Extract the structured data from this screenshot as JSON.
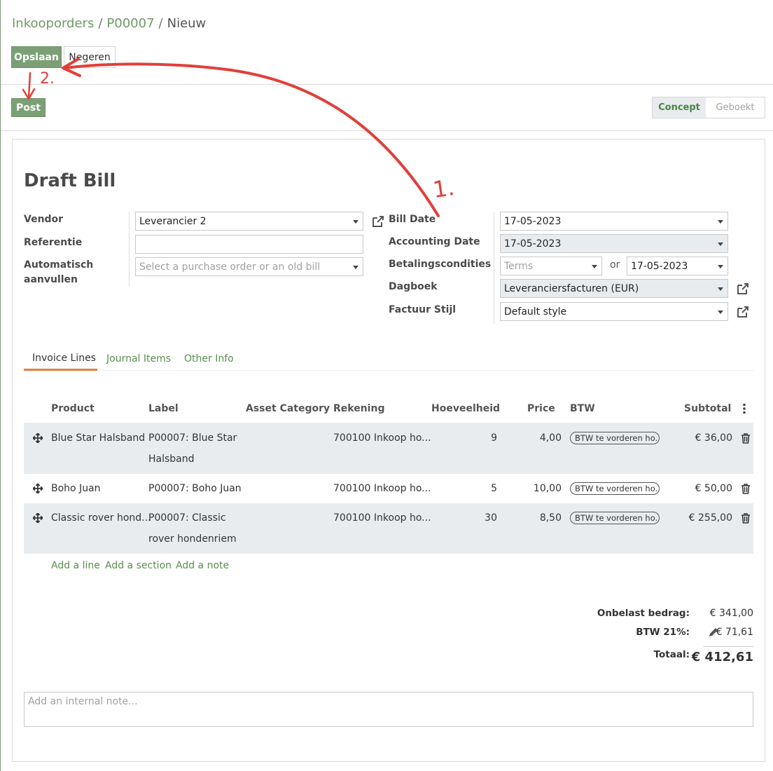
{
  "breadcrumb": {
    "root": "Inkooporders",
    "order": "P00007",
    "current": "Nieuw",
    "sep": "/"
  },
  "toolbar": {
    "save_label": "Opslaan",
    "discard_label": "Negeren",
    "post_label": "Post"
  },
  "status": {
    "active": "Concept",
    "next": "Geboekt"
  },
  "form": {
    "title": "Draft Bill",
    "vendor_label": "Vendor",
    "vendor_value": "Leverancier 2",
    "reference_label": "Referentie",
    "reference_value": "",
    "autofill_label_1": "Automatisch",
    "autofill_label_2": "aanvullen",
    "autofill_placeholder": "Select a purchase order or an old bill",
    "bill_date_label": "Bill Date",
    "bill_date_value": "17-05-2023",
    "accounting_date_label": "Accounting Date",
    "accounting_date_value": "17-05-2023",
    "payment_terms_label": "Betalingscondities",
    "terms_placeholder": "Terms",
    "or_label": "or",
    "due_date_value": "17-05-2023",
    "journal_label": "Dagboek",
    "journal_value": "Leveranciersfacturen (EUR)",
    "invoice_style_label": "Factuur Stijl",
    "invoice_style_value": "Default style"
  },
  "tabs": [
    {
      "label": "Invoice Lines",
      "active": true
    },
    {
      "label": "Journal Items",
      "active": false
    },
    {
      "label": "Other Info",
      "active": false
    }
  ],
  "table": {
    "headers": {
      "product": "Product",
      "label": "Label",
      "asset": "Asset Category ...",
      "account": "Rekening",
      "qty": "Hoeveelheid",
      "price": "Price",
      "tax": "BTW",
      "subtotal": "Subtotal"
    },
    "rows": [
      {
        "product": "Blue Star Halsband",
        "label_1": "P00007: Blue Star",
        "label_2": "Halsband",
        "account": "700100 Inkoop ho...",
        "qty": "9",
        "price": "4,00",
        "tax": "BTW te vorderen ho...",
        "subtotal": "€ 36,00"
      },
      {
        "product": "Boho Juan",
        "label_1": "P00007: Boho Juan",
        "label_2": "",
        "account": "700100 Inkoop ho...",
        "qty": "5",
        "price": "10,00",
        "tax": "BTW te vorderen ho...",
        "subtotal": "€ 50,00"
      },
      {
        "product": "Classic rover hond...",
        "label_1": "P00007: Classic",
        "label_2": "rover hondenriem",
        "account": "700100 Inkoop ho...",
        "qty": "30",
        "price": "8,50",
        "tax": "BTW te vorderen ho...",
        "subtotal": "€ 255,00"
      }
    ],
    "add_line": "Add a line",
    "add_section": "Add a section",
    "add_note": "Add a note"
  },
  "totals": {
    "untaxed_label": "Onbelast bedrag:",
    "untaxed_value": "€ 341,00",
    "tax_label": "BTW 21%:",
    "tax_value": "€ 71,61",
    "total_label": "Totaal:",
    "total_value": "€ 412,61"
  },
  "note_placeholder": "Add an internal note...",
  "annotation": {
    "step1": "1.",
    "step2": "2.",
    "color": "#e0403a"
  },
  "colors": {
    "primary": "#7c9f76",
    "link": "#5b8e52",
    "tab_accent": "#e57f3d",
    "row_band": "#e9ecef"
  }
}
